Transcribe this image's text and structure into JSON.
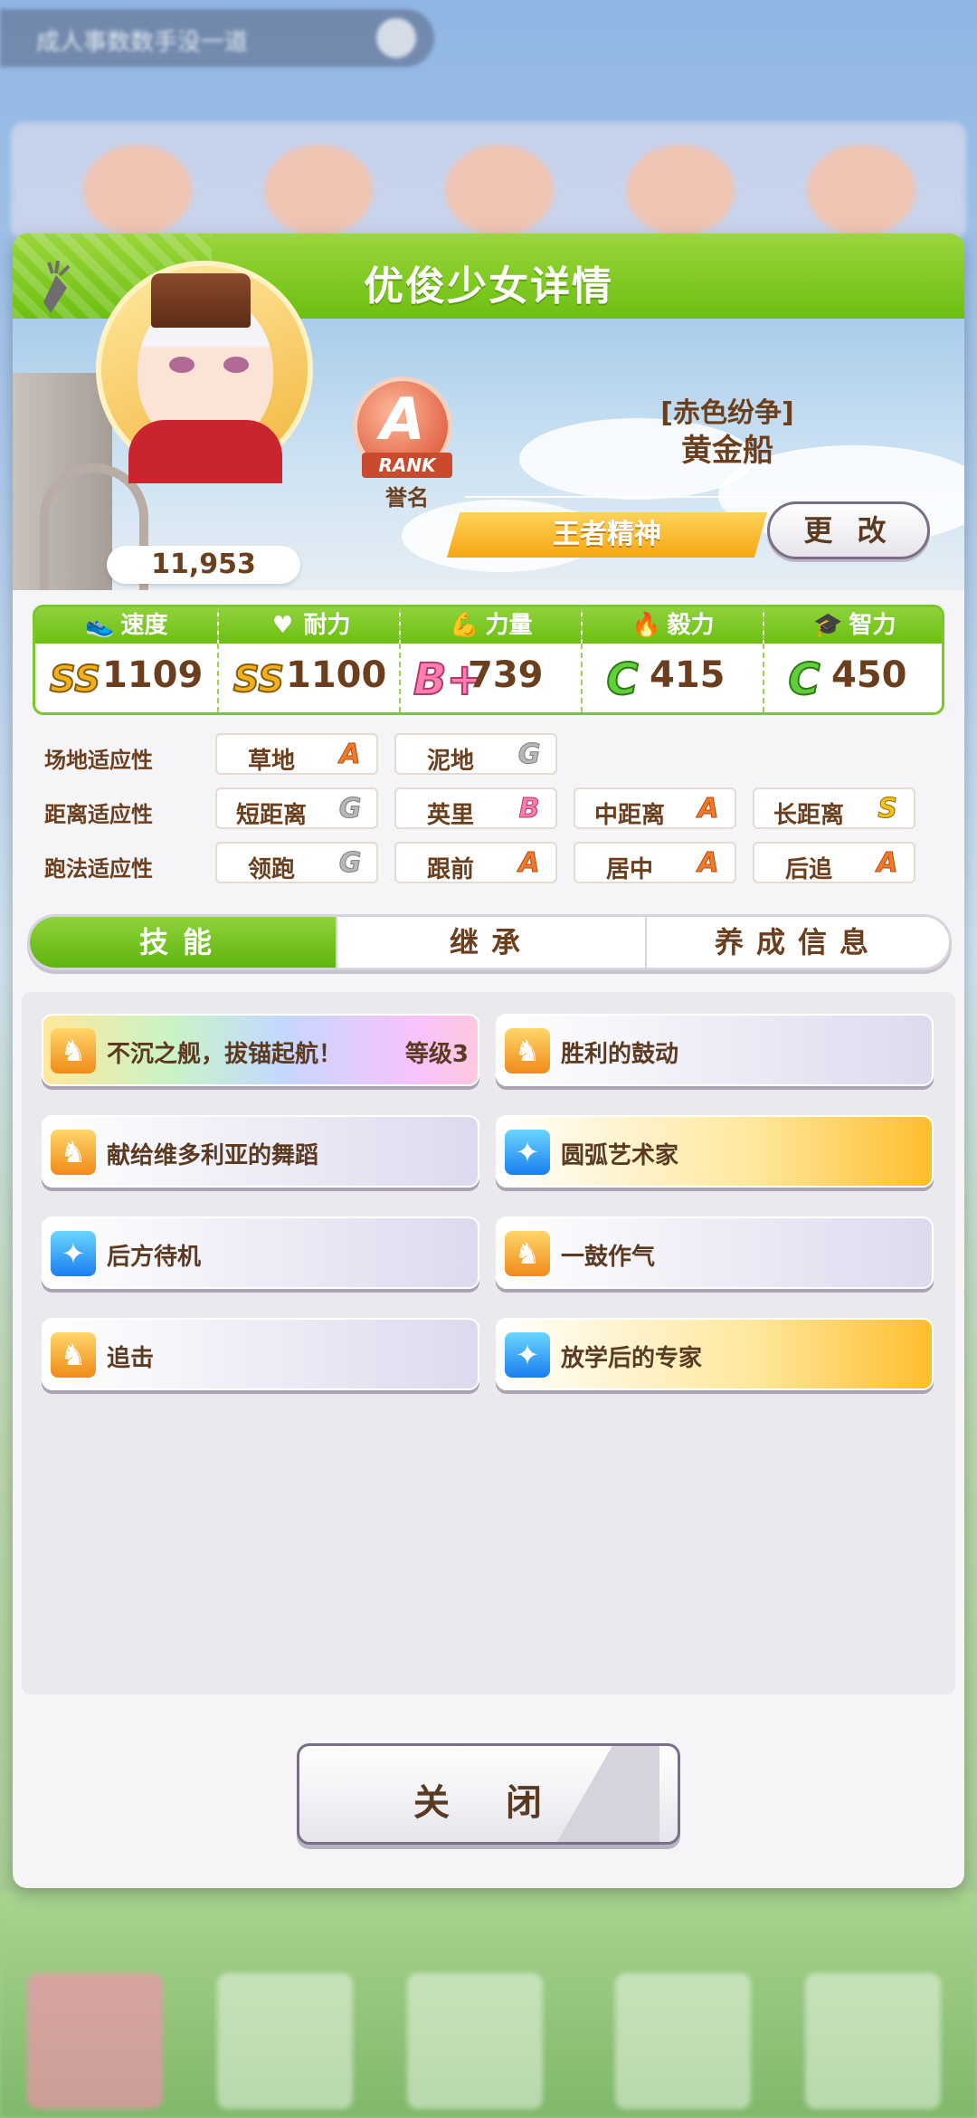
{
  "background": {
    "top_banner_text": "成人事数数手没一道"
  },
  "panel": {
    "title": "优俊少女详情"
  },
  "profile": {
    "fans": "11,953",
    "rank_letter": "A",
    "rank_ribbon": "RANK",
    "rank_caption": "誉名",
    "subtitle": "[赤色纷争]",
    "name": "黄金船",
    "title_plate": "王者精神",
    "change_label": "更 改"
  },
  "stats": [
    {
      "icon": "shoe-icon",
      "glyph": "👟",
      "label": "速度",
      "grade": "SS",
      "grade_class": "ss",
      "value": "1109"
    },
    {
      "icon": "heart-icon",
      "glyph": "♥",
      "label": "耐力",
      "grade": "SS",
      "grade_class": "ss",
      "value": "1100"
    },
    {
      "icon": "muscle-icon",
      "glyph": "💪",
      "label": "力量",
      "grade": "B+",
      "grade_class": "b",
      "value": "739"
    },
    {
      "icon": "flame-icon",
      "glyph": "🔥",
      "label": "毅力",
      "grade": "C",
      "grade_class": "c",
      "value": "415"
    },
    {
      "icon": "graduation-cap-icon",
      "glyph": "🎓",
      "label": "智力",
      "grade": "C",
      "grade_class": "c",
      "value": "450"
    }
  ],
  "aptitude": {
    "track_label": "场地适应性",
    "track": [
      {
        "name": "草地",
        "grade": "A"
      },
      {
        "name": "泥地",
        "grade": "G"
      }
    ],
    "distance_label": "距离适应性",
    "distance": [
      {
        "name": "短距离",
        "grade": "G"
      },
      {
        "name": "英里",
        "grade": "B"
      },
      {
        "name": "中距离",
        "grade": "A"
      },
      {
        "name": "长距离",
        "grade": "S"
      }
    ],
    "style_label": "跑法适应性",
    "style": [
      {
        "name": "领跑",
        "grade": "G"
      },
      {
        "name": "跟前",
        "grade": "A"
      },
      {
        "name": "居中",
        "grade": "A"
      },
      {
        "name": "后追",
        "grade": "A"
      }
    ]
  },
  "tabs": [
    {
      "label": "技能",
      "active": true
    },
    {
      "label": "继承",
      "active": false
    },
    {
      "label": "养成信息",
      "active": false
    }
  ],
  "skills": [
    {
      "name": "不沉之舰，拔锚起航！",
      "level": "等级3",
      "style": "rainbow",
      "icon_color": "orange"
    },
    {
      "name": "胜利的鼓动",
      "level": "",
      "style": "plain",
      "icon_color": "orange"
    },
    {
      "name": "献给维多利亚的舞蹈",
      "level": "",
      "style": "plain",
      "icon_color": "orange"
    },
    {
      "name": "圆弧艺术家",
      "level": "",
      "style": "gold",
      "icon_color": "blue"
    },
    {
      "name": "后方待机",
      "level": "",
      "style": "plain",
      "icon_color": "blue"
    },
    {
      "name": "一鼓作气",
      "level": "",
      "style": "plain",
      "icon_color": "orange"
    },
    {
      "name": "追击",
      "level": "",
      "style": "plain",
      "icon_color": "orange"
    },
    {
      "name": "放学后的专家",
      "level": "",
      "style": "gold",
      "icon_color": "blue"
    }
  ],
  "close_label": "关 闭"
}
